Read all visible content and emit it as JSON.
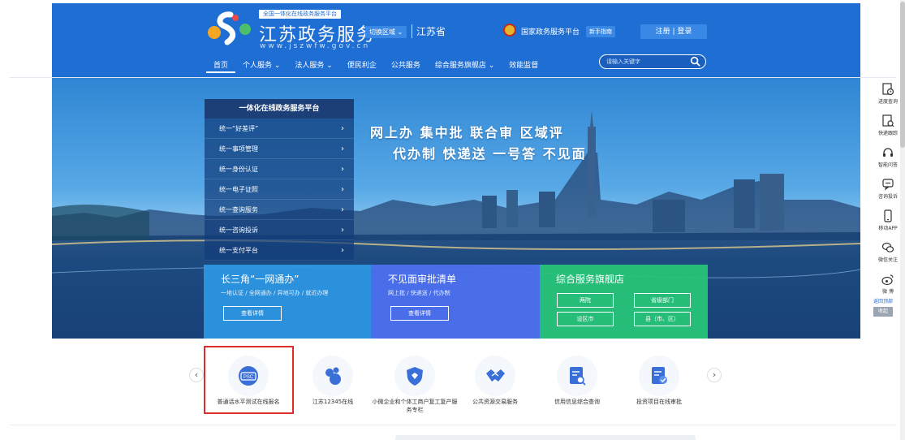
{
  "header": {
    "badge": "全国一体化在线政务服务平台",
    "title": "江苏政务服务",
    "url": "www.jszwfw.gov.cn",
    "region_button": "切换区域 ⌄",
    "region_name": "江苏省",
    "gov_platform": "国家政务服务平台",
    "guide": "新手指南",
    "auth": "注册 | 登录",
    "nav": [
      {
        "label": "首页",
        "active": true
      },
      {
        "label": "个人服务 ⌄"
      },
      {
        "label": "法人服务 ⌄"
      },
      {
        "label": "便民利企"
      },
      {
        "label": "公共服务"
      },
      {
        "label": "综合服务旗舰店 ⌄"
      },
      {
        "label": "效能监督"
      }
    ],
    "search_placeholder": "请输入关键字"
  },
  "banner": {
    "menu_title": "一体化在线政务服务平台",
    "menu_items": [
      "统一“好差评”",
      "统一事项管理",
      "统一身份认证",
      "统一电子证照",
      "统一查询服务",
      "统一咨询投诉",
      "统一支付平台"
    ],
    "slogan_line1": "网上办  集中批  联合审  区域评",
    "slogan_line2": "代办制  快递送  一号答  不见面",
    "cards": [
      {
        "title": "长三角“一网通办”",
        "subtitle": "一地认证 / 全网通办 / 异地可办 / 就近办理",
        "button": "查看详情"
      },
      {
        "title": "不见面审批清单",
        "subtitle": "网上批 / 快递送 / 代办制",
        "button": "查看详情"
      },
      {
        "title": "综合服务旗舰店",
        "buttons": [
          "两院",
          "省级部门",
          "设区市",
          "县（市、区）"
        ]
      }
    ]
  },
  "services": [
    {
      "label": "普通话水平测试在线报名",
      "icon": "psc-icon",
      "color": "#3a6fd8"
    },
    {
      "label": "江苏12345在线",
      "icon": "droplets-icon",
      "color": "#3a6fd8"
    },
    {
      "label": "小微企业和个体工商户复工复产服务专栏",
      "icon": "shield-icon",
      "color": "#3a6fd8"
    },
    {
      "label": "公共资源交易服务",
      "icon": "handshake-icon",
      "color": "#3a6fd8"
    },
    {
      "label": "信用信息综合查询",
      "icon": "doc-search-icon",
      "color": "#3a6fd8"
    },
    {
      "label": "投资项目在线审批",
      "icon": "doc-check-icon",
      "color": "#3a6fd8"
    }
  ],
  "float_bar": {
    "items": [
      "进度查询",
      "快递跟踪",
      "智能问答",
      "咨询投诉",
      "移动APP",
      "微信关注",
      "微 博"
    ],
    "back_top": "返回顶部",
    "collapse": "收起"
  }
}
